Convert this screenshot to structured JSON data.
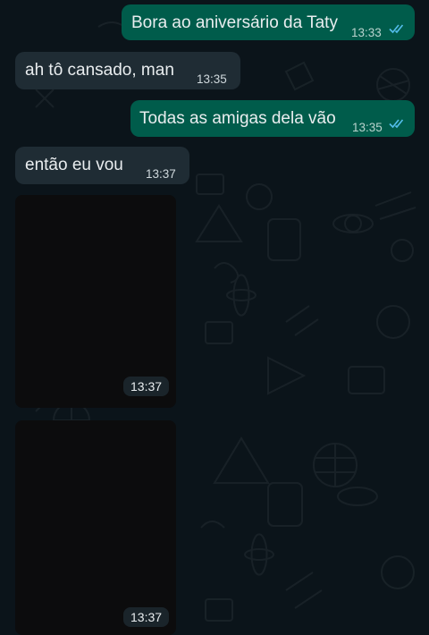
{
  "chat": {
    "messages": [
      {
        "direction": "outgoing",
        "text": "Bora ao aniversário da Taty",
        "time": "13:33",
        "status": "read"
      },
      {
        "direction": "incoming",
        "text": "ah tô cansado, man",
        "time": "13:35"
      },
      {
        "direction": "outgoing",
        "text": "Todas as amigas dela vão",
        "time": "13:35",
        "status": "read"
      },
      {
        "direction": "incoming",
        "text": "então eu vou",
        "time": "13:37"
      },
      {
        "direction": "incoming",
        "type": "media",
        "time": "13:37"
      },
      {
        "direction": "incoming",
        "type": "media",
        "time": "13:37"
      }
    ]
  },
  "colors": {
    "background": "#0b141a",
    "outgoing_bubble": "#005c4b",
    "incoming_bubble": "#1f2c34",
    "read_ticks": "#53bdeb"
  },
  "icons": {
    "read_status": "double-check-icon"
  }
}
